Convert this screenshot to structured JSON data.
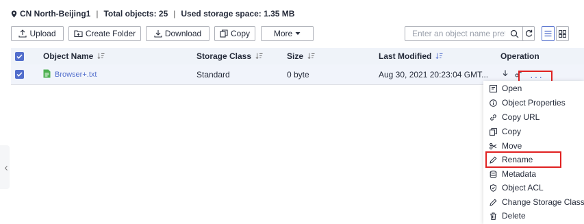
{
  "info": {
    "region": "CN North-Beijing1",
    "separator": "|",
    "total_objects": "Total objects: 25",
    "storage_used": "Used storage space: 1.35 MB"
  },
  "toolbar": {
    "upload": "Upload",
    "create_folder": "Create Folder",
    "download": "Download",
    "copy": "Copy",
    "more": "More",
    "search_placeholder": "Enter an object name prefix."
  },
  "table": {
    "headers": [
      "Object Name",
      "Storage Class",
      "Size",
      "Last Modified",
      "Operation"
    ],
    "rows": [
      {
        "name": "Browser+.txt",
        "storage_class": "Standard",
        "size": "0 byte",
        "last_modified": "Aug 30, 2021 20:23:04 GMT..."
      }
    ],
    "more_label": "···"
  },
  "menu": {
    "items": [
      {
        "label": "Open",
        "icon": "open-icon"
      },
      {
        "label": "Object Properties",
        "icon": "info-icon"
      },
      {
        "label": "Copy URL",
        "icon": "link-icon"
      },
      {
        "label": "Copy",
        "icon": "copy-icon"
      },
      {
        "label": "Move",
        "icon": "scissors-icon"
      },
      {
        "label": "Rename",
        "icon": "pencil-icon"
      },
      {
        "label": "Metadata",
        "icon": "database-icon"
      },
      {
        "label": "Object ACL",
        "icon": "shield-icon"
      },
      {
        "label": "Change Storage Class",
        "icon": "pencil-icon"
      },
      {
        "label": "Delete",
        "icon": "trash-icon"
      }
    ]
  },
  "colors": {
    "accent": "#526ecc",
    "highlight_border": "#e02020",
    "header_bg": "#eff3f9",
    "row_bg": "#f1f4fb",
    "file_icon": "#4caf50"
  }
}
